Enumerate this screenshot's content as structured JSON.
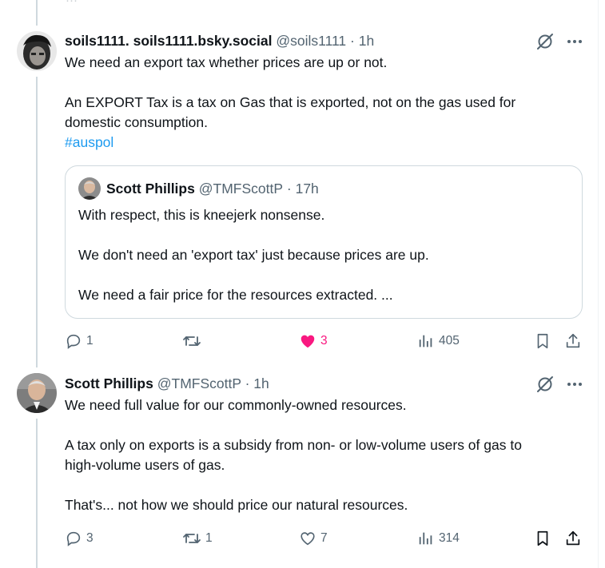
{
  "top_fade_text": "···",
  "posts": [
    {
      "display_name": "soils1111. soils1111.bsky.social",
      "handle": "@soils1111",
      "separator": "·",
      "time": "1h",
      "lines": [
        "We need an export tax whether prices are up or not.",
        "An EXPORT Tax is a tax on Gas that is exported, not on the gas used for",
        "domestic consumption."
      ],
      "hashtag": "#auspol",
      "quote": {
        "display_name": "Scott Phillips",
        "handle": "@TMFScottP",
        "separator": "·",
        "time": "17h",
        "lines": [
          "With respect, this is kneejerk nonsense.",
          "We don't need an 'export tax' just because prices are up.",
          "We need a fair price for the resources extracted. ..."
        ]
      },
      "actions": {
        "replies": "1",
        "reposts": "",
        "likes": "3",
        "views": "405"
      }
    },
    {
      "display_name": "Scott Phillips",
      "handle": "@TMFScottP",
      "separator": "·",
      "time": "1h",
      "lines": [
        "We need full value for our commonly-owned resources.",
        "A tax only on exports is a subsidy from non- or low-volume users of gas to",
        "high-volume users of gas.",
        "That's... not how we should price our natural resources."
      ],
      "actions": {
        "replies": "3",
        "reposts": "1",
        "likes": "7",
        "views": "314"
      }
    }
  ],
  "colors": {
    "text": "#0f1419",
    "secondary": "#536471",
    "link": "#1d9bf0",
    "like": "#f91880",
    "border": "#cfd9de"
  },
  "icons": [
    "grok-icon",
    "more-icon",
    "reply-icon",
    "repost-icon",
    "heart-icon",
    "views-icon",
    "bookmark-icon",
    "share-icon"
  ]
}
